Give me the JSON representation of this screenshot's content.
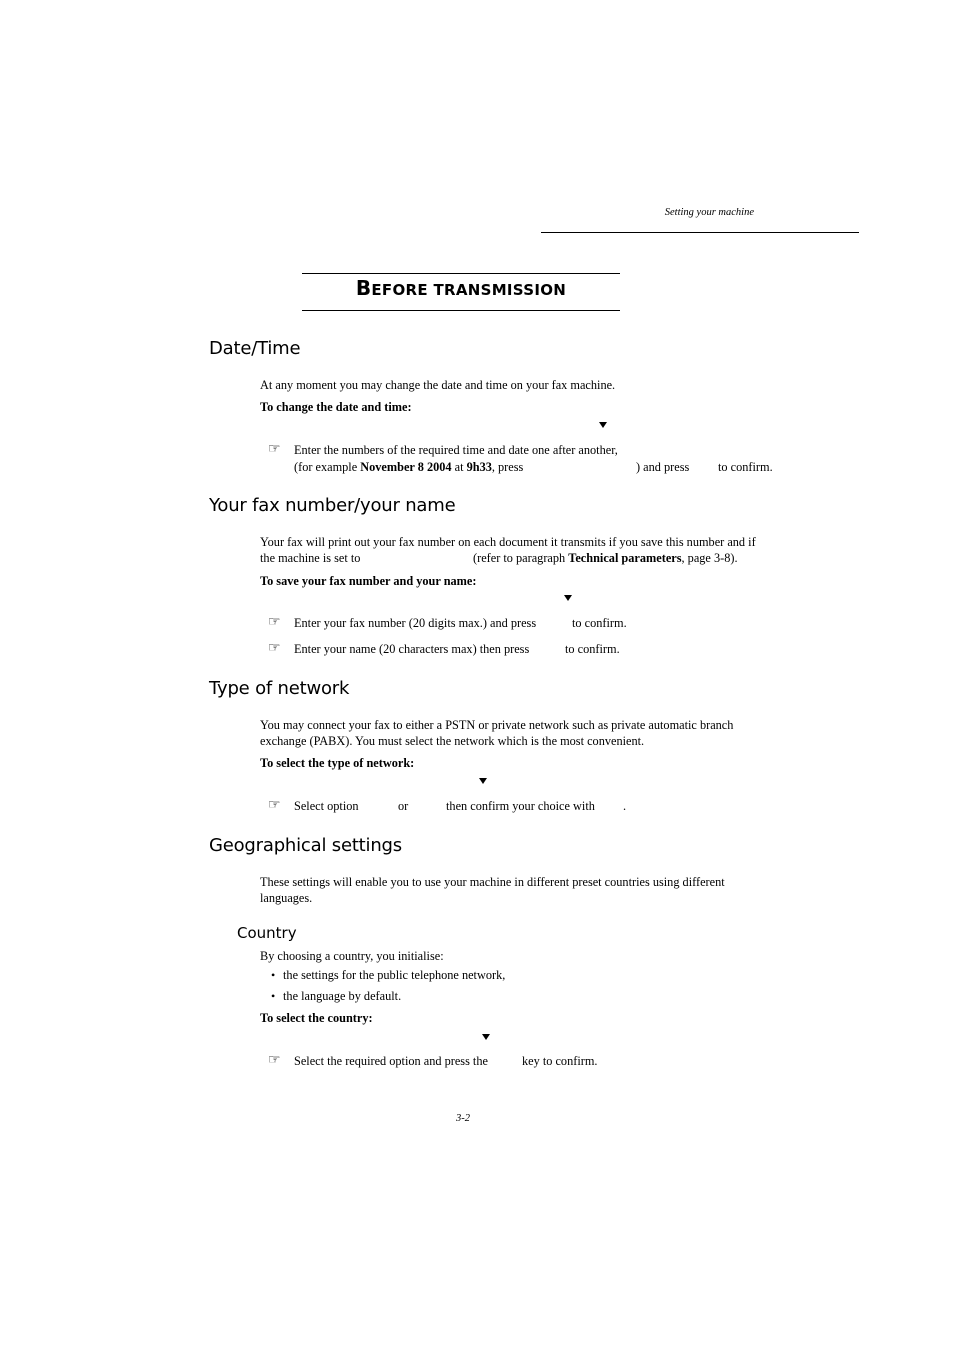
{
  "header": {
    "running_title": "Setting your machine"
  },
  "chapter": {
    "title_first_letter": "B",
    "title_rest": "EFORE TRANSMISSION"
  },
  "sections": {
    "date_time": {
      "heading": "Date/Time",
      "intro": "At any moment you may change the date and time on your fax machine.",
      "procedure_label": "To change the date and time:",
      "step1_line1": "Enter the numbers of the required time and date one after another,",
      "step1_line2_a": "(for example ",
      "step1_line2_bold1": "November 8 2004",
      "step1_line2_b": " at ",
      "step1_line2_bold2": "9h33",
      "step1_line2_c": ", press",
      "step1_line2_d": ") and press",
      "step1_line2_e": "to confirm."
    },
    "fax_number": {
      "heading": "Your fax number/your name",
      "intro_line1": "Your fax will print out your fax number on each document it transmits if you save this number and if",
      "intro_line2_a": "the machine is set to",
      "intro_line2_b": "(refer to paragraph ",
      "intro_line2_bold": "Technical parameters",
      "intro_line2_c": ", page 3-8).",
      "procedure_label": "To save your fax number and your name:",
      "step1_a": "Enter your fax number (20 digits max.) and press",
      "step1_b": "to confirm.",
      "step2_a": "Enter your name (20 characters max) then press",
      "step2_b": "to confirm."
    },
    "network": {
      "heading": "Type of network",
      "intro_line1": "You may connect your fax to either a PSTN or private network such as private automatic branch",
      "intro_line2": "exchange (PABX). You must select the network which is the most convenient.",
      "procedure_label": "To select the type of network:",
      "step1_a": "Select option",
      "step1_b": "or",
      "step1_c": "then confirm your choice with",
      "step1_d": "."
    },
    "geographical": {
      "heading": "Geographical settings",
      "intro_line1": "These settings will enable you to use your machine in different preset countries using different",
      "intro_line2": "languages.",
      "country": {
        "heading": "Country",
        "intro": "By choosing a country, you initialise:",
        "bullets": [
          "the settings for the public telephone network,",
          "the language by default."
        ],
        "procedure_label": "To select the country:",
        "step1_a": "Select the required option and press the",
        "step1_b": "key to confirm."
      }
    }
  },
  "icons": {
    "hand": "☞",
    "bullet": "•"
  },
  "footer": {
    "page_number": "3-2"
  }
}
